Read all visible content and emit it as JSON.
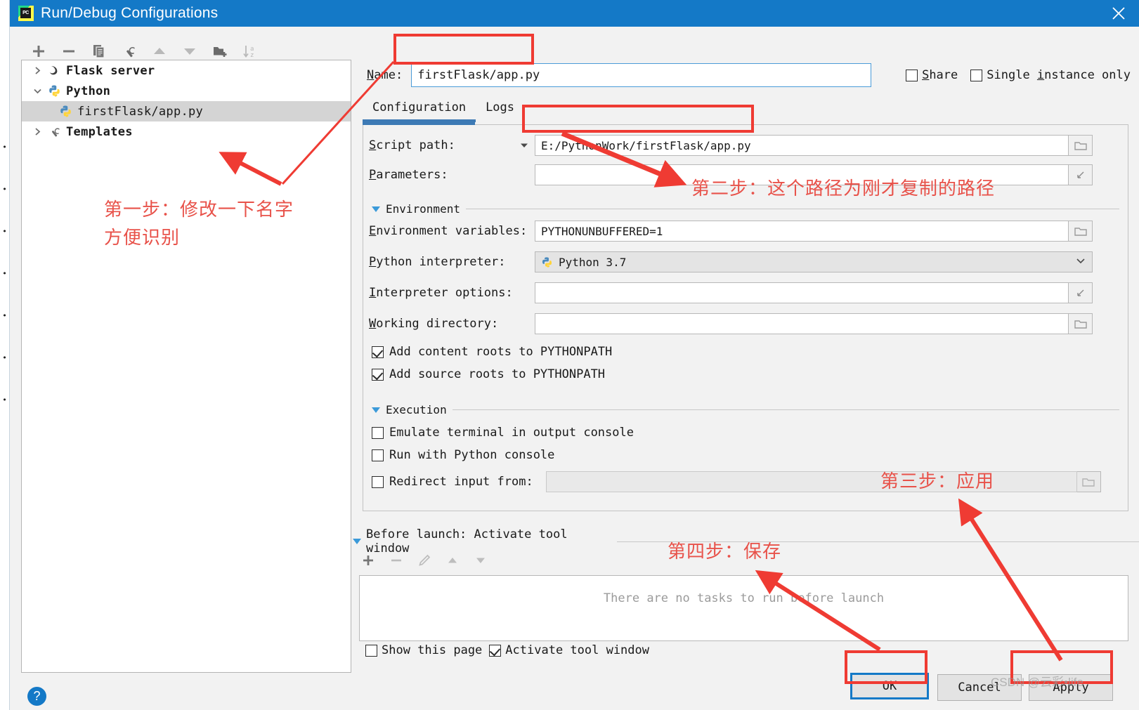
{
  "window": {
    "title": "Run/Debug Configurations",
    "app_icon": "pycharm-icon",
    "close_icon": "close-icon",
    "titlebar_color": "#1479c7"
  },
  "tree_toolbar": {
    "items": [
      {
        "name": "add-configuration-button",
        "icon": "plus-icon",
        "label": "+"
      },
      {
        "name": "remove-configuration-button",
        "icon": "minus-icon",
        "label": "−"
      },
      {
        "name": "copy-configuration-button",
        "icon": "copy-icon",
        "label": "Copy"
      },
      {
        "name": "edit-templates-button",
        "icon": "wrench-icon",
        "label": "Edit Templates"
      },
      {
        "name": "move-up-button",
        "icon": "arrow-up-icon",
        "label": "Move Up"
      },
      {
        "name": "move-down-button",
        "icon": "arrow-down-icon",
        "label": "Move Down"
      },
      {
        "name": "new-folder-button",
        "icon": "folder-add-icon",
        "label": "New Folder"
      },
      {
        "name": "sort-button",
        "icon": "sort-az-icon",
        "label": "Sort Configurations"
      }
    ]
  },
  "tree": {
    "rows": [
      {
        "label": "Flask server",
        "icon": "flask-icon",
        "twisty": "collapsed",
        "depth": 0,
        "selected": false,
        "bold": true
      },
      {
        "label": "Python",
        "icon": "python-icon",
        "twisty": "expanded",
        "depth": 0,
        "selected": false,
        "bold": true
      },
      {
        "label": "firstFlask/app.py",
        "icon": "python-icon",
        "twisty": "none",
        "depth": 1,
        "selected": true,
        "bold": false
      },
      {
        "label": "Templates",
        "icon": "wrench-icon",
        "twisty": "collapsed",
        "depth": 0,
        "selected": false,
        "bold": true
      }
    ]
  },
  "name_field": {
    "label": "Name:",
    "label_mnemonic": "N",
    "value": "firstFlask/app.py",
    "placeholder": ""
  },
  "top_options": [
    {
      "label": "Share",
      "mnemonic": "S",
      "checked": false,
      "name": "share-checkbox"
    },
    {
      "label": "Single instance only",
      "mnemonic": "i",
      "checked": false,
      "name": "single-instance-only-checkbox"
    }
  ],
  "tabs": [
    {
      "label": "Configuration",
      "active": true,
      "name": "tab-configuration"
    },
    {
      "label": "Logs",
      "active": false,
      "name": "tab-logs"
    }
  ],
  "configuration": {
    "script_path": {
      "label": "Script path:",
      "label_mnemonic": "S",
      "value": "E:/PythonWork/firstFlask/app.py",
      "dropdown_icon": "chevron-down-icon",
      "browse_icon": "folder-icon"
    },
    "parameters": {
      "label": "Parameters:",
      "label_mnemonic": "P",
      "value": "",
      "expand_icon": "expand-icon"
    },
    "environment_section": {
      "title": "Environment",
      "collapsed": false,
      "toggle_icon": "triangle-down-icon"
    },
    "environment_variables": {
      "label": "Environment variables:",
      "label_mnemonic": "E",
      "value": "PYTHONUNBUFFERED=1",
      "browse_icon": "folder-icon"
    },
    "python_interpreter": {
      "label": "Python interpreter:",
      "label_mnemonic": "P",
      "value": "Python 3.7",
      "value_icon": "python-icon",
      "dropdown_icon": "chevron-down-icon"
    },
    "interpreter_options": {
      "label": "Interpreter options:",
      "label_mnemonic": "I",
      "value": "",
      "expand_icon": "expand-icon"
    },
    "working_directory": {
      "label": "Working directory:",
      "label_mnemonic": "W",
      "value": "",
      "browse_icon": "folder-icon"
    },
    "path_checkboxes": [
      {
        "label": "Add content roots to PYTHONPATH",
        "checked": true,
        "name": "add-content-roots-checkbox"
      },
      {
        "label": "Add source roots to PYTHONPATH",
        "checked": true,
        "name": "add-source-roots-checkbox"
      }
    ],
    "execution_section": {
      "title": "Execution",
      "collapsed": false,
      "toggle_icon": "triangle-down-icon"
    },
    "execution_checkboxes": [
      {
        "label": "Emulate terminal in output console",
        "checked": false,
        "name": "emulate-terminal-checkbox"
      },
      {
        "label": "Run with Python console",
        "checked": false,
        "name": "run-with-python-console-checkbox"
      },
      {
        "label": "Redirect input from:",
        "checked": false,
        "name": "redirect-input-checkbox"
      }
    ],
    "redirect_input_value": ""
  },
  "before_launch": {
    "title": "Before launch: Activate tool window",
    "title_mnemonic": "B",
    "toggle_icon": "triangle-down-icon",
    "toolbar": [
      {
        "name": "add-task-button",
        "icon": "plus-icon"
      },
      {
        "name": "remove-task-button",
        "icon": "minus-icon"
      },
      {
        "name": "edit-task-button",
        "icon": "pencil-icon"
      },
      {
        "name": "move-task-up-button",
        "icon": "arrow-up-icon"
      },
      {
        "name": "move-task-down-button",
        "icon": "arrow-down-icon"
      }
    ],
    "empty_text": "There are no tasks to run before launch",
    "options": [
      {
        "label": "Show this page",
        "checked": false,
        "name": "show-this-page-checkbox"
      },
      {
        "label": "Activate tool window",
        "checked": true,
        "name": "activate-tool-window-checkbox"
      }
    ]
  },
  "footer": {
    "help_label": "?",
    "buttons": [
      {
        "label": "OK",
        "primary": true,
        "name": "ok-button"
      },
      {
        "label": "Cancel",
        "primary": false,
        "name": "cancel-button"
      },
      {
        "label": "Apply",
        "primary": false,
        "name": "apply-button"
      }
    ]
  },
  "annotations": {
    "color": "#e8524a",
    "box_color": "#ef3b33",
    "notes": [
      {
        "id": "step1",
        "line1": "第一步：修改一下名字",
        "line2": "方便识别"
      },
      {
        "id": "step2",
        "line1": "第二步：这个路径为刚才复制的路径",
        "line2": ""
      },
      {
        "id": "step3",
        "line1": "第三步：应用",
        "line2": ""
      },
      {
        "id": "step4",
        "line1": "第四步：保存",
        "line2": ""
      }
    ]
  },
  "watermark": {
    "text": "CSDN @云彩•life"
  }
}
